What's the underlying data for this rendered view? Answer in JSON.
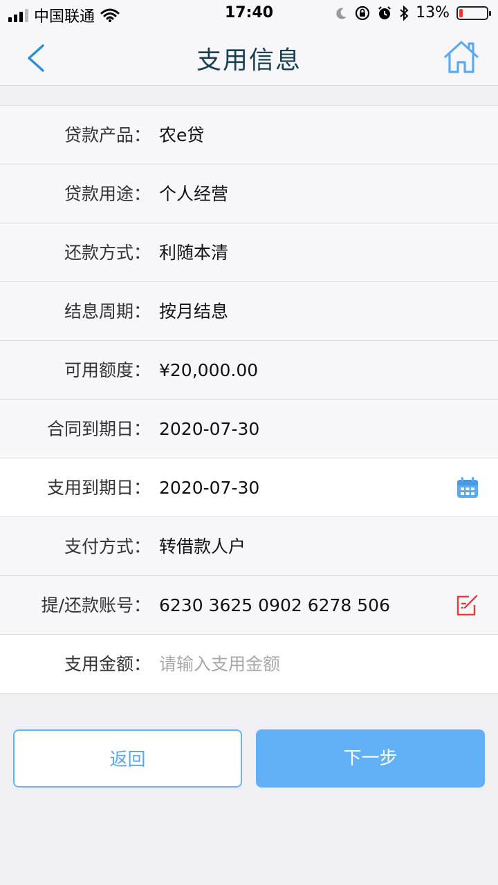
{
  "status_bar": {
    "carrier": "中国联通",
    "time": "17:40",
    "battery": "13%",
    "battery_level": 0.13
  },
  "header": {
    "title": "支用信息",
    "back_icon": "chevron-left-icon",
    "home_icon": "home-icon"
  },
  "form": {
    "rows": [
      {
        "label": "贷款产品：",
        "value": "农e贷"
      },
      {
        "label": "贷款用途：",
        "value": "个人经营"
      },
      {
        "label": "还款方式：",
        "value": "利随本清"
      },
      {
        "label": "结息周期：",
        "value": "按月结息"
      },
      {
        "label": "可用额度：",
        "value": "¥20,000.00"
      },
      {
        "label": "合同到期日：",
        "value": "2020-07-30"
      },
      {
        "label": "支用到期日：",
        "value": "2020-07-30",
        "icon": "calendar-icon"
      },
      {
        "label": "支付方式：",
        "value": "转借款人户"
      },
      {
        "label": "提/还款账号：",
        "value": "6230 3625 0902 6278 506",
        "icon": "edit-icon"
      },
      {
        "label": "支用金额：",
        "value": "",
        "placeholder": "请输入支用金额"
      }
    ]
  },
  "buttons": {
    "back": "返回",
    "next": "下一步"
  },
  "colors": {
    "accent": "#62b1f7",
    "title": "#1b3f52",
    "edit_icon": "#d9413f",
    "battery_low": "#e8392f"
  }
}
